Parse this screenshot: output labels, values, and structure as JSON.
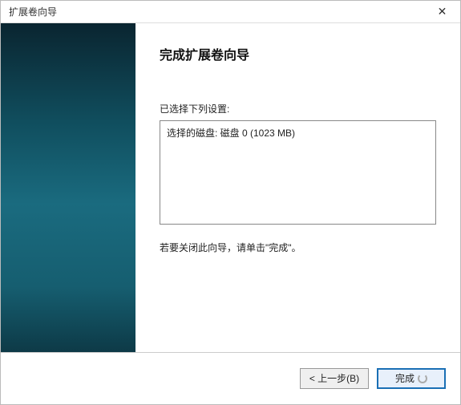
{
  "titlebar": {
    "title": "扩展卷向导"
  },
  "wizard": {
    "heading": "完成扩展卷向导",
    "settings_label": "已选择下列设置:",
    "summary": "选择的磁盘: 磁盘 0 (1023 MB)",
    "finish_hint": "若要关闭此向导，请单击\"完成\"。"
  },
  "footer": {
    "back_label": "< 上一步(B)",
    "finish_label": "完成"
  }
}
